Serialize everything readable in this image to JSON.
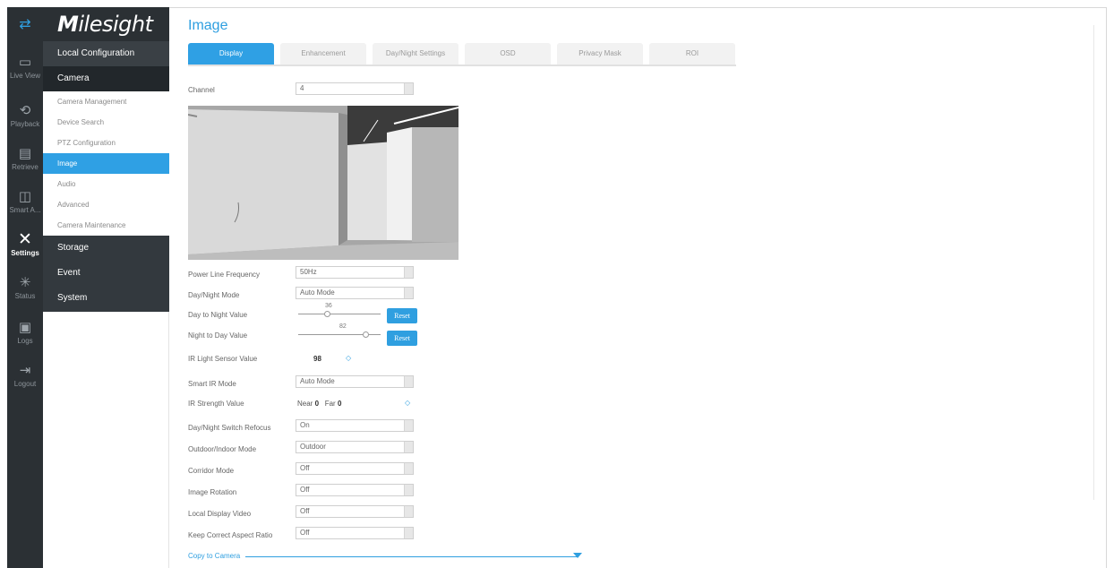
{
  "rail": {
    "items": [
      {
        "icon": "live-view-icon",
        "glyph": "▭",
        "label": "Live View"
      },
      {
        "icon": "playback-icon",
        "glyph": "⟲",
        "label": "Playback"
      },
      {
        "icon": "retrieve-icon",
        "glyph": "▤",
        "label": "Retrieve"
      },
      {
        "icon": "smart-analysis-icon",
        "glyph": "◫",
        "label": "Smart A..."
      },
      {
        "icon": "settings-icon",
        "glyph": "✕",
        "label": "Settings"
      },
      {
        "icon": "status-icon",
        "glyph": "✳",
        "label": "Status"
      },
      {
        "icon": "logs-icon",
        "glyph": "▣",
        "label": "Logs"
      },
      {
        "icon": "logout-icon",
        "glyph": "⇥",
        "label": "Logout"
      }
    ]
  },
  "brand": {
    "logo_text_bold": "M",
    "logo_text_rest": "ilesight"
  },
  "menu": {
    "local_configuration": "Local Configuration",
    "camera": "Camera",
    "camera_items": [
      "Camera Management",
      "Device Search",
      "PTZ Configuration",
      "Image",
      "Audio",
      "Advanced",
      "Camera Maintenance"
    ],
    "storage": "Storage",
    "event": "Event",
    "system": "System"
  },
  "page": {
    "title": "Image",
    "tabs": [
      "Display",
      "Enhancement",
      "Day/Night Settings",
      "OSD",
      "Privacy Mask",
      "ROI"
    ]
  },
  "form": {
    "channel_label": "Channel",
    "channel_value": "4",
    "power_line_frequency_label": "Power Line Frequency",
    "power_line_frequency_value": "50Hz",
    "day_night_mode_label": "Day/Night Mode",
    "day_night_mode_value": "Auto Mode",
    "day_to_night_label": "Day to Night Value",
    "day_to_night_value": "36",
    "night_to_day_label": "Night to Day Value",
    "night_to_day_value": "82",
    "reset_label": "Reset",
    "ir_light_sensor_label": "IR Light Sensor Value",
    "ir_light_sensor_value": "98",
    "smart_ir_mode_label": "Smart IR Mode",
    "smart_ir_mode_value": "Auto Mode",
    "ir_strength_label": "IR Strength Value",
    "ir_near_label": "Near",
    "ir_near_value": "0",
    "ir_far_label": "Far",
    "ir_far_value": "0",
    "refocus_label": "Day/Night Switch Refocus",
    "refocus_value": "On",
    "outdoor_indoor_label": "Outdoor/Indoor Mode",
    "outdoor_indoor_value": "Outdoor",
    "corridor_label": "Corridor Mode",
    "corridor_value": "Off",
    "rotation_label": "Image Rotation",
    "rotation_value": "Off",
    "local_display_label": "Local Display Video",
    "local_display_value": "Off",
    "aspect_ratio_label": "Keep Correct Aspect Ratio",
    "aspect_ratio_value": "Off",
    "copy_to_camera": "Copy to Camera"
  },
  "colors": {
    "accent": "#2fa0e4",
    "rail_bg": "#2b3034",
    "menu_dark": "#33393e"
  }
}
